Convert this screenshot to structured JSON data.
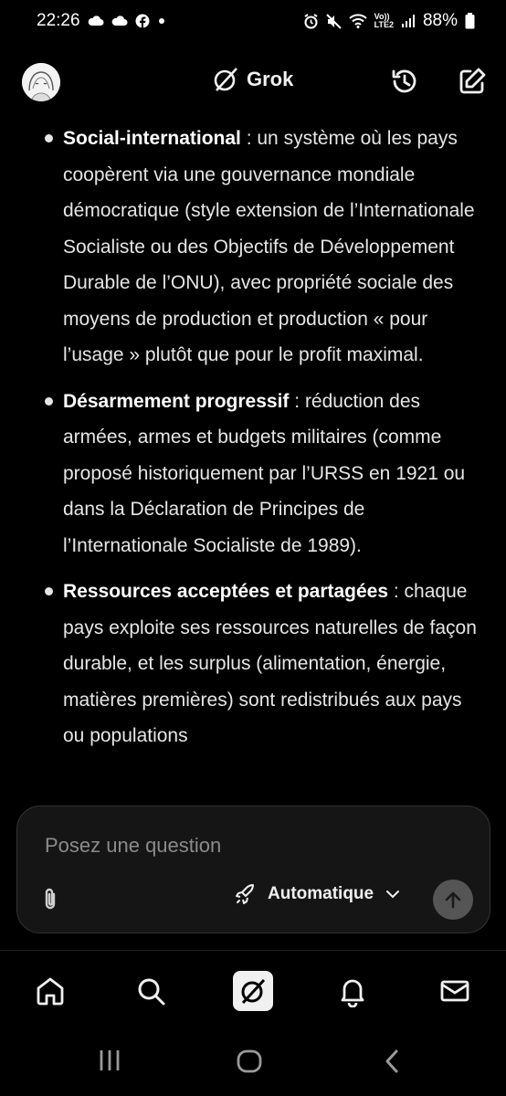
{
  "status_bar": {
    "time": "22:26",
    "network_label_top": "Vo))",
    "network_label_bottom": "LTE2",
    "battery": "88%",
    "left_icons": [
      "cloud-icon",
      "cloud-icon",
      "facebook-icon",
      "dot-icon"
    ],
    "right_icons": [
      "alarm-icon",
      "mute-icon",
      "wifi-icon",
      "signal-icon",
      "battery-icon"
    ]
  },
  "header": {
    "title": "Grok",
    "left": "avatar",
    "right_icons": [
      "history-icon",
      "new-chat-icon"
    ]
  },
  "message": {
    "bullets": [
      {
        "term": "Social-international",
        "text": " : un système où les pays coopèrent via une gouvernance mondiale démocratique (style extension de l’Internationale Socialiste ou des Objectifs de Développement Durable de l’ONU), avec propriété sociale des moyens de production et production « pour l’usage » plutôt que pour le profit maximal."
      },
      {
        "term": "Désarmement progressif",
        "text": " : réduction des armées, armes et budgets militaires (comme proposé historiquement par l’URSS en 1921 ou dans la Déclaration de Principes de l’Internationale Socialiste de 1989)."
      },
      {
        "term": "Ressources acceptées et partagées",
        "text": " : chaque pays exploite ses ressources naturelles de façon durable, et les surplus (alimentation, énergie, matières premières) sont redistribués aux pays ou populations"
      }
    ]
  },
  "composer": {
    "placeholder": "Posez une question",
    "mode": "Automatique"
  },
  "bottom_nav": {
    "items": [
      "home-icon",
      "search-icon",
      "grok-icon",
      "notifications-icon",
      "messages-icon"
    ]
  },
  "system_nav": {
    "items": [
      "recents-icon",
      "home-button-icon",
      "back-icon"
    ]
  },
  "colors": {
    "background": "#000000",
    "text": "#e6e6e6",
    "composer_bg": "#151515",
    "placeholder": "#8b8b8b",
    "send_bg": "#555555"
  }
}
